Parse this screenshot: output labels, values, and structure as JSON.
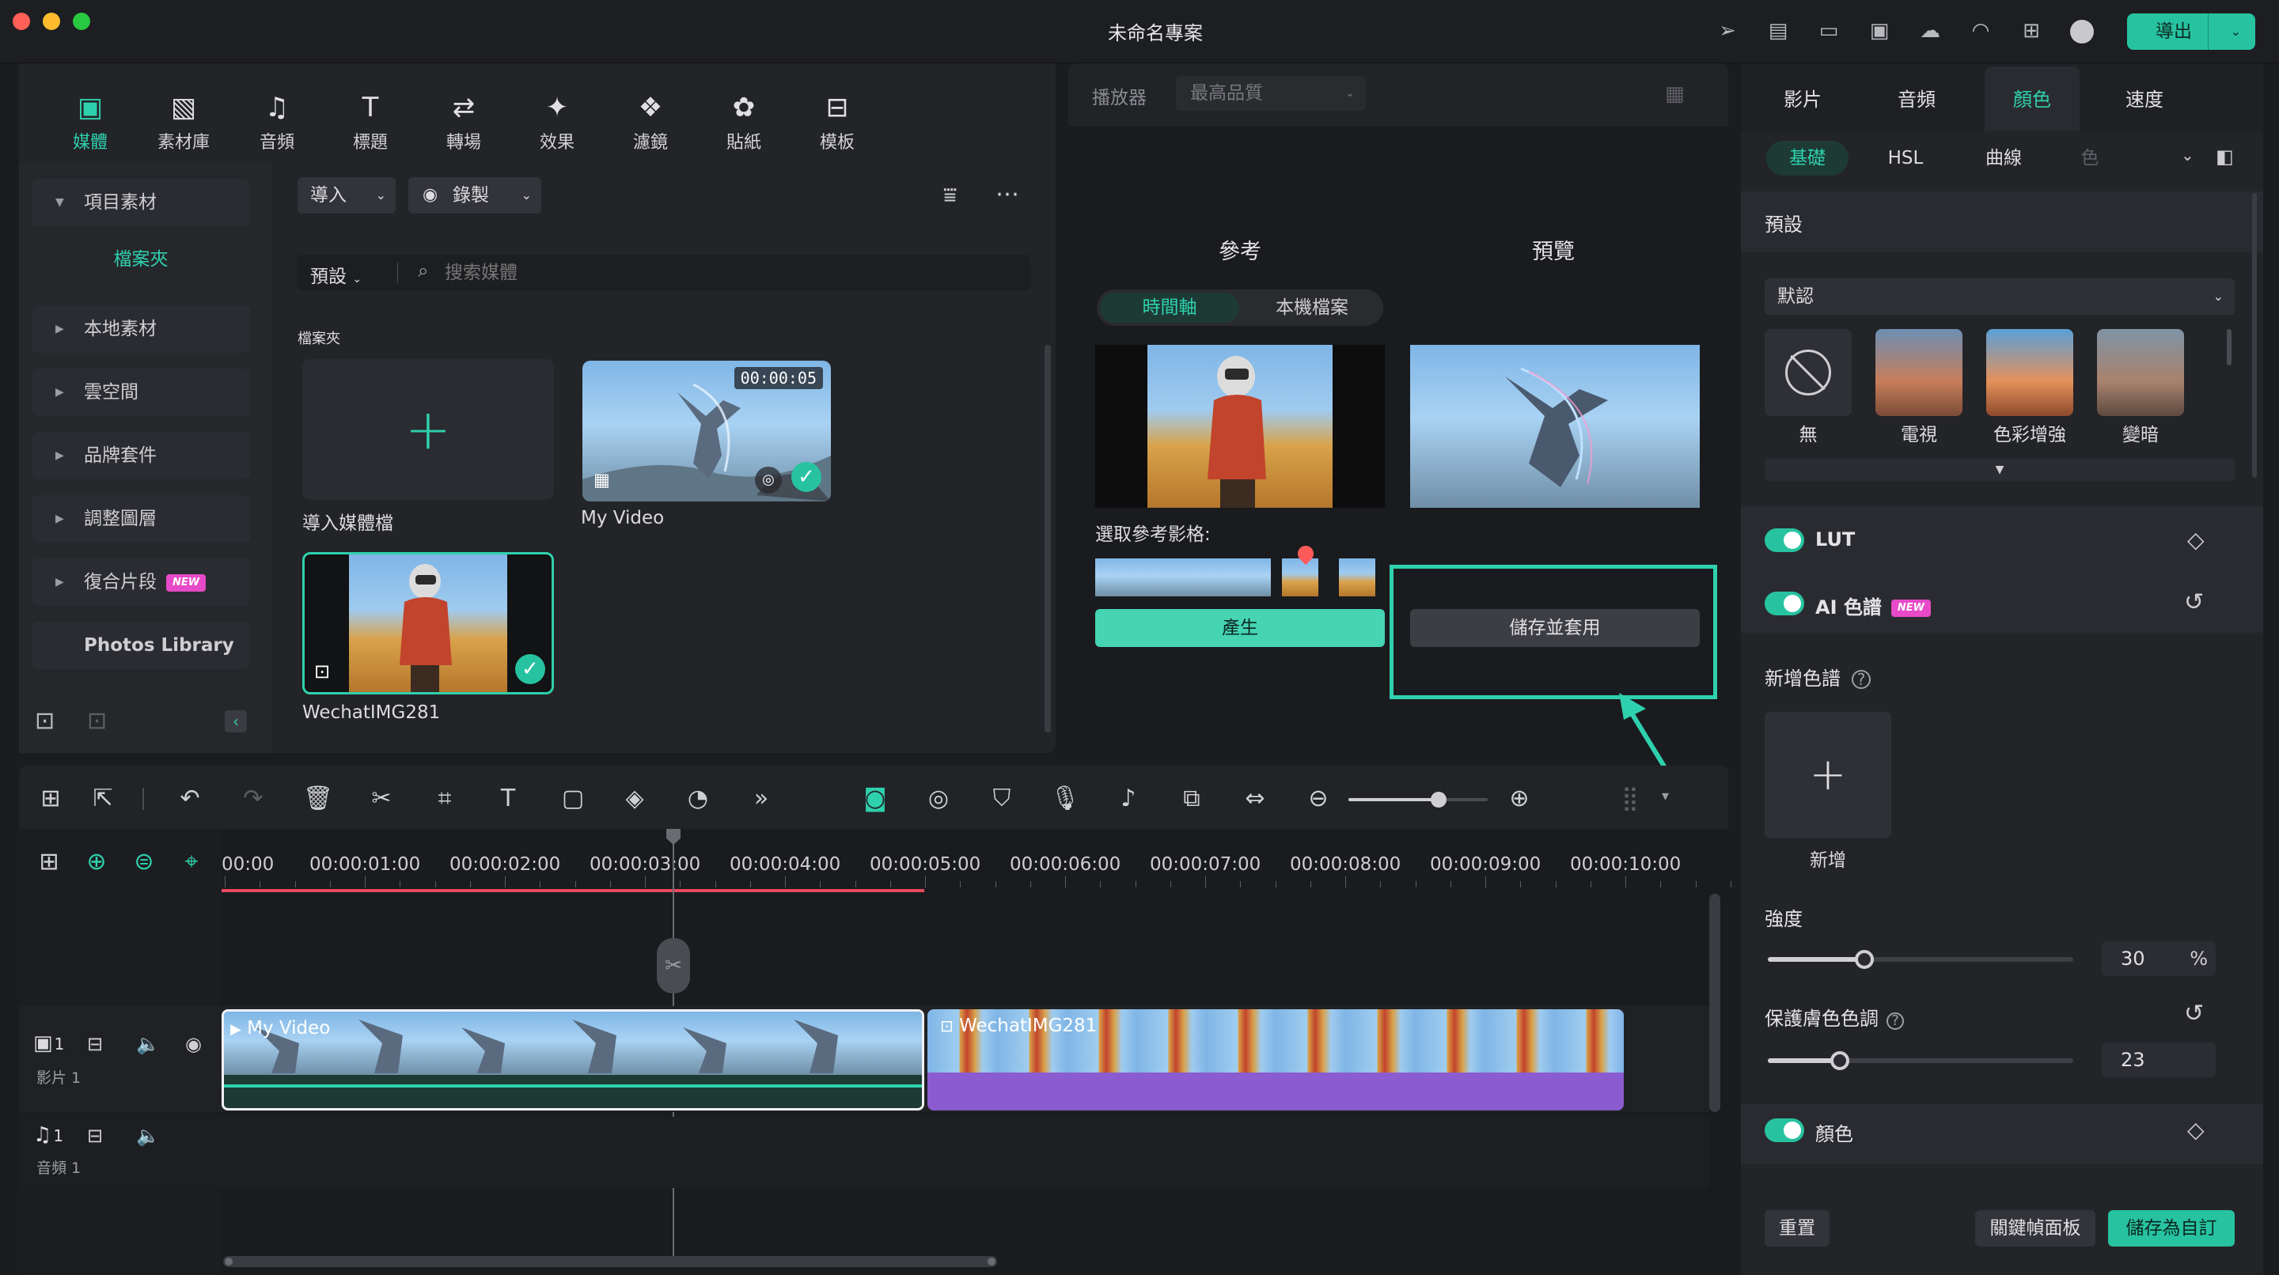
{
  "window": {
    "title": "未命名專案",
    "export_label": "導出"
  },
  "toolbar": {
    "items": [
      {
        "label": "媒體",
        "icon": "media-icon"
      },
      {
        "label": "素材庫",
        "icon": "stock-icon"
      },
      {
        "label": "音頻",
        "icon": "music-icon"
      },
      {
        "label": "標題",
        "icon": "title-icon"
      },
      {
        "label": "轉場",
        "icon": "transition-icon"
      },
      {
        "label": "效果",
        "icon": "effects-icon"
      },
      {
        "label": "濾鏡",
        "icon": "filter-icon"
      },
      {
        "label": "貼紙",
        "icon": "sticker-icon"
      },
      {
        "label": "模板",
        "icon": "template-icon"
      }
    ]
  },
  "sidebar": {
    "project_media": "項目素材",
    "folder": "檔案夾",
    "items": [
      "本地素材",
      "雲空間",
      "品牌套件",
      "調整圖層",
      "復合片段"
    ],
    "new_badge": "NEW",
    "photos_library": "Photos Library"
  },
  "media": {
    "import_label": "導入",
    "record_label": "錄製",
    "sort_label": "預設",
    "search_placeholder": "搜索媒體",
    "folder_label": "檔案夾",
    "import_tile_label": "導入媒體檔",
    "clips": [
      {
        "name": "My Video",
        "duration": "00:00:05"
      },
      {
        "name": "WechatIMG281"
      }
    ]
  },
  "player": {
    "label": "播放器",
    "quality": "最高品質"
  },
  "color_match": {
    "reference_title": "參考",
    "preview_title": "預覽",
    "tabs": [
      "時間軸",
      "本機檔案"
    ],
    "select_frame_label": "選取參考影格:",
    "generate_label": "產生",
    "save_apply_label": "儲存並套用"
  },
  "right_panel": {
    "tabs": [
      "影片",
      "音頻",
      "顏色",
      "速度"
    ],
    "subtabs": [
      "基礎",
      "HSL",
      "曲線",
      "色"
    ],
    "preset_section": "預設",
    "preset_select": "默認",
    "presets": [
      "無",
      "電視",
      "色彩增強",
      "變暗"
    ],
    "lut_label": "LUT",
    "ai_palette_label": "AI 色譜",
    "new_badge": "NEW",
    "add_palette_label": "新增色譜",
    "add_label": "新增",
    "strength_label": "強度",
    "strength_value": "30",
    "strength_unit": "%",
    "strength_fraction": 0.3,
    "skin_label": "保護膚色色調",
    "skin_value": "23",
    "skin_fraction": 0.23,
    "color_label": "顏色",
    "reset_label": "重置",
    "keyframe_label": "關鍵幀面板",
    "save_custom_label": "儲存為自訂"
  },
  "timeline": {
    "ruler": [
      "00:00",
      "00:00:01:00",
      "00:00:02:00",
      "00:00:03:00",
      "00:00:04:00",
      "00:00:05:00",
      "00:00:06:00",
      "00:00:07:00",
      "00:00:08:00",
      "00:00:09:00",
      "00:00:10:00"
    ],
    "video_track": {
      "number": "1",
      "name": "影片 1"
    },
    "audio_track": {
      "number": "1",
      "name": "音頻 1"
    },
    "clips": [
      {
        "name": "My Video"
      },
      {
        "name": "WechatIMG281"
      }
    ],
    "zoom_fraction": 0.65
  },
  "colors": {
    "accent": "#27c3a0",
    "new_badge": "#e64ac8",
    "purple_clip": "#8a5cd0",
    "highlight_frame": "#2fd0ad"
  }
}
